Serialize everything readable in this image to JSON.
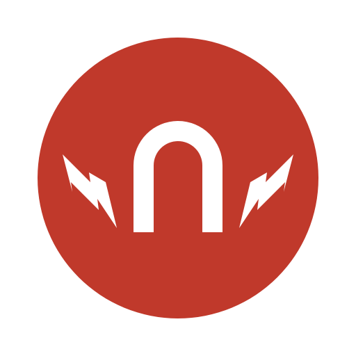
{
  "logo": {
    "icon": "magnet-icon",
    "colors": {
      "background": "#ffffff",
      "disc": "#c0392b",
      "glyph": "#ffffff"
    },
    "parts": [
      "red-circle",
      "horseshoe-magnet",
      "lightning-bolt-left",
      "lightning-bolt-right"
    ]
  }
}
